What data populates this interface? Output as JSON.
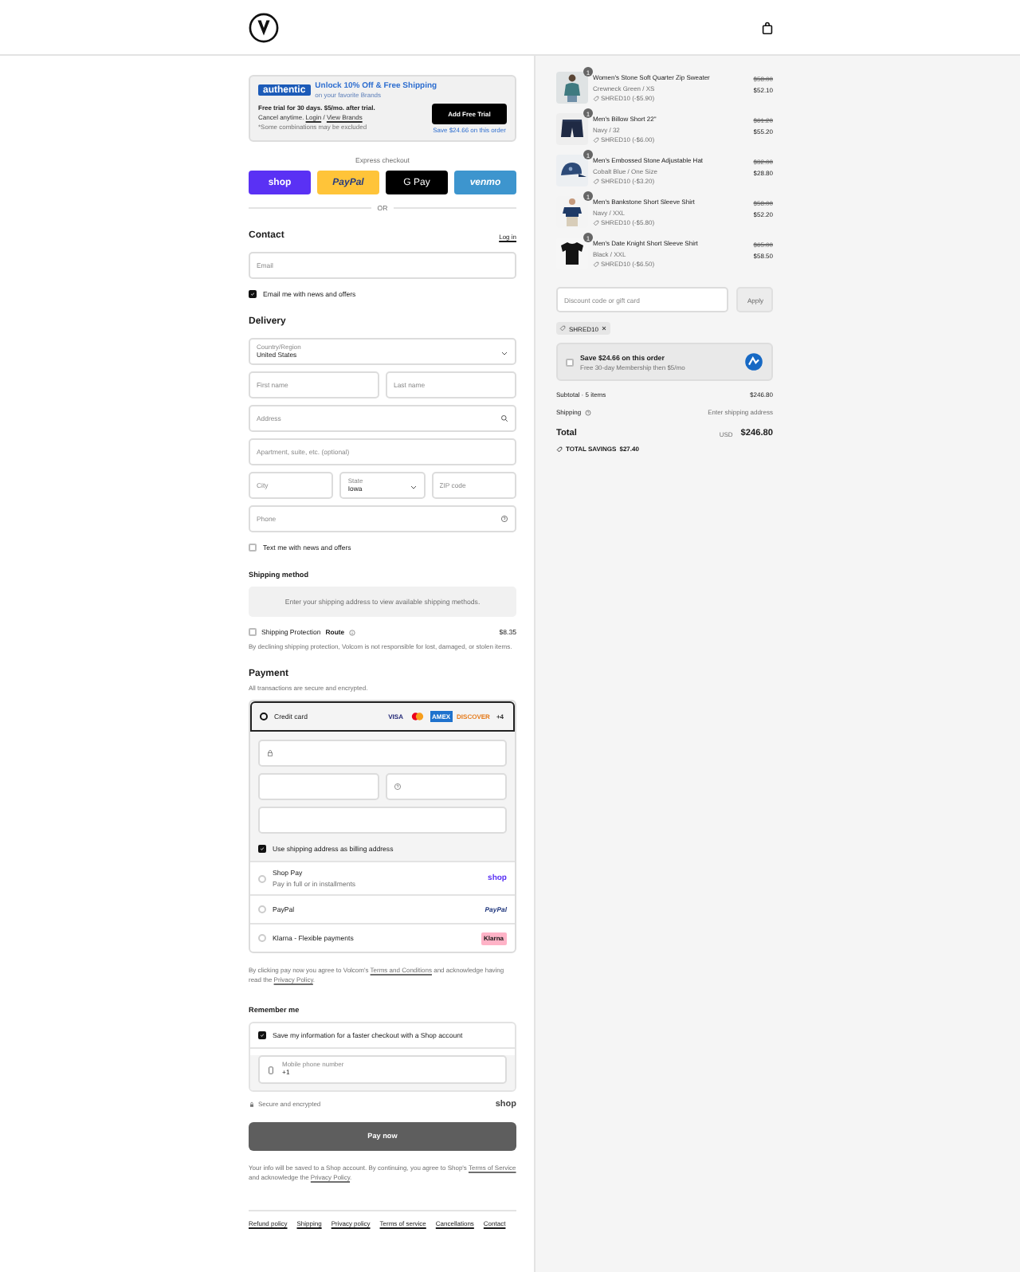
{
  "promo": {
    "brand": "authentic",
    "title": "Unlock 10% Off & Free Shipping",
    "subtitle": "on your favorite Brands",
    "trial": "Free trial for 30 days. $5/mo. after trial.",
    "cancel": [
      {
        "kind": "text",
        "text": "Cancel anytime. "
      },
      {
        "kind": "link",
        "text": "Login"
      },
      {
        "kind": "text",
        "text": " / "
      },
      {
        "kind": "link",
        "text": "View Brands"
      }
    ],
    "note": "*Some combinations may be excluded",
    "button": "Add Free Trial",
    "button_note": "Save $24.66 on this order"
  },
  "express": {
    "label": "Express checkout",
    "buttons": [
      {
        "kind": "shop",
        "label": "shop"
      },
      {
        "kind": "paypal",
        "label": "PayPal"
      },
      {
        "kind": "gpay",
        "label": "G Pay"
      },
      {
        "kind": "venmo",
        "label": "venmo"
      }
    ],
    "divider": "OR"
  },
  "contact": {
    "heading": "Contact",
    "login": "Log in",
    "email_placeholder": "Email",
    "news": {
      "label": "Email me with news and offers",
      "checked": true
    }
  },
  "delivery": {
    "heading": "Delivery",
    "country_label": "Country/Region",
    "country": "United States",
    "first_name_placeholder": "First name",
    "last_name_placeholder": "Last name",
    "address": "Address",
    "apartment_placeholder": "Apartment, suite, etc. (optional)",
    "city_placeholder": "City",
    "state_label": "State",
    "state": "Iowa",
    "zip_placeholder": "ZIP code",
    "phone": "Phone",
    "text_me": {
      "label": "Text me with news and offers",
      "checked": false
    }
  },
  "shipping_method": {
    "heading": "Shipping method",
    "message": "Enter your shipping address to view available shipping methods."
  },
  "protection": {
    "checked": false,
    "label": "Shipping Protection",
    "brand": "Route",
    "price": "$8.35",
    "note": "By declining shipping protection, Volcom is not responsible for lost, damaged, or stolen items."
  },
  "payment": {
    "heading": "Payment",
    "subtitle": "All transactions are secure and encrypted.",
    "card_brands": [
      {
        "kind": "visa",
        "label": "VISA"
      },
      {
        "kind": "mastercard"
      },
      {
        "kind": "amex",
        "label": "AMEX"
      },
      {
        "kind": "discover",
        "label": "DISCOVER"
      },
      {
        "kind": "more",
        "label": "+4"
      }
    ],
    "methods": [
      {
        "kind": "card",
        "label": "Credit card",
        "selected": true
      },
      {
        "kind": "shop",
        "label": "Shop Pay",
        "sub": "Pay in full or in installments",
        "logo": "shop",
        "selected": false
      },
      {
        "kind": "paypal",
        "label": "PayPal",
        "logo": "PayPal",
        "selected": false
      },
      {
        "kind": "klarna",
        "label": "Klarna - Flexible payments",
        "logo": "Klarna",
        "selected": false
      }
    ],
    "billing": {
      "label": "Use shipping address as billing address",
      "checked": true
    }
  },
  "consent": [
    {
      "kind": "text",
      "text": "By clicking pay now you agree to Volcom's "
    },
    {
      "kind": "link",
      "text": "Terms and Conditions"
    },
    {
      "kind": "text",
      "text": " and acknowledge having read the "
    },
    {
      "kind": "link",
      "text": "Privacy Policy"
    },
    {
      "kind": "text",
      "text": "."
    }
  ],
  "remember": {
    "heading": "Remember me",
    "save": {
      "label": "Save my information for a faster checkout with a Shop account",
      "checked": true
    },
    "phone_label": "Mobile phone number",
    "phone_value": "+1",
    "secure": "Secure and encrypted",
    "logo": "shop"
  },
  "pay_button": "Pay now",
  "footnote": [
    {
      "kind": "text",
      "text": "Your info will be saved to a Shop account. By continuing, you agree to Shop's "
    },
    {
      "kind": "link",
      "text": "Terms of Service"
    },
    {
      "kind": "text",
      "text": " and acknowledge the "
    },
    {
      "kind": "link",
      "text": "Privacy Policy"
    },
    {
      "kind": "text",
      "text": "."
    }
  ],
  "footer_links": [
    "Refund policy",
    "Shipping",
    "Privacy policy",
    "Terms of service",
    "Cancellations",
    "Contact"
  ],
  "items": [
    {
      "quantity": "1",
      "name": "Women's Stone Soft Quarter Zip Sweater",
      "variant": "Crewneck Green / XS",
      "discount": "SHRED10 (-$5.90)",
      "old_price": "$58.00",
      "price": "$52.10"
    },
    {
      "quantity": "1",
      "name": "Men's Billow Short 22\"",
      "variant": "Navy / 32",
      "discount": "SHRED10 (-$6.00)",
      "old_price": "$61.20",
      "price": "$55.20"
    },
    {
      "quantity": "1",
      "name": "Men's Embossed Stone Adjustable Hat",
      "variant": "Cobalt Blue / One Size",
      "discount": "SHRED10 (-$3.20)",
      "old_price": "$32.00",
      "price": "$28.80"
    },
    {
      "quantity": "1",
      "name": "Men's Bankstone Short Sleeve Shirt",
      "variant": "Navy / XXL",
      "discount": "SHRED10 (-$5.80)",
      "old_price": "$58.00",
      "price": "$52.20"
    },
    {
      "quantity": "1",
      "name": "Men's Date Knight Short Sleeve Shirt",
      "variant": "Black / XXL",
      "discount": "SHRED10 (-$6.50)",
      "old_price": "$65.00",
      "price": "$58.50"
    }
  ],
  "discount": {
    "placeholder": "Discount code or gift card",
    "button": "Apply",
    "tag": "SHRED10"
  },
  "savings_offer": {
    "checked": false,
    "title": "Save $24.66 on this order",
    "sub": "Free 30-day Membership then $5/mo"
  },
  "summary": {
    "subtotal_label": "Subtotal · 5 items",
    "subtotal": "$246.80",
    "shipping_label": "Shipping",
    "shipping": "Enter shipping address",
    "total_label": "Total",
    "currency": "USD",
    "total": "$246.80",
    "savings_label": "TOTAL SAVINGS",
    "savings": "$27.40"
  }
}
